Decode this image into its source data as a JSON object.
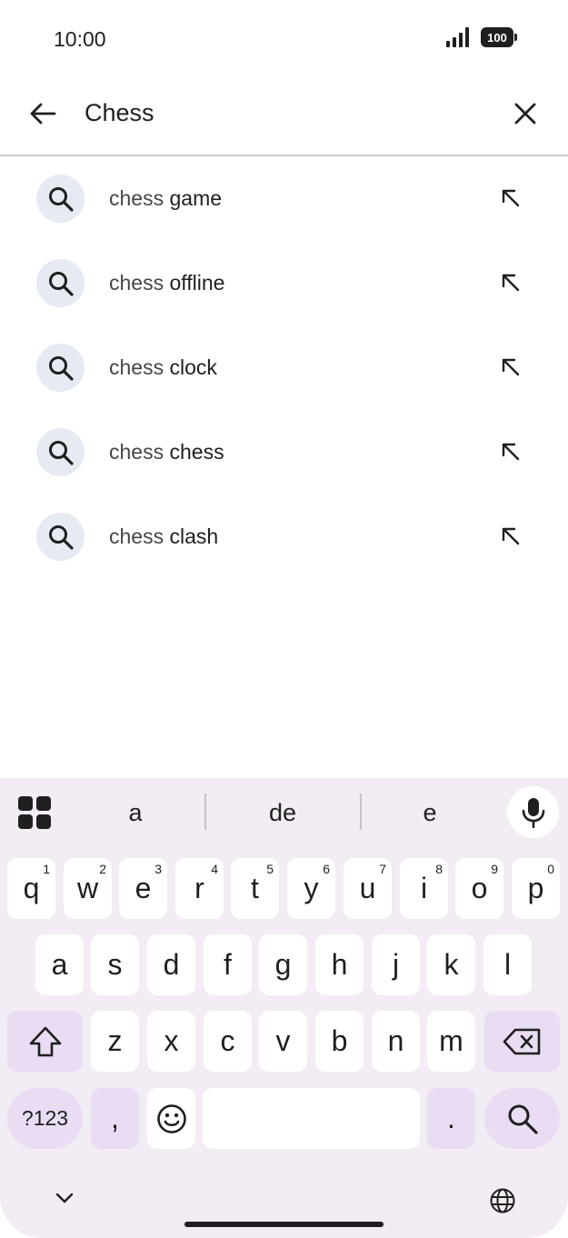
{
  "status": {
    "time": "10:00",
    "battery": "100",
    "signal": "signal-icon"
  },
  "search": {
    "query": "Chess",
    "back": "back-arrow-icon",
    "clear": "close-icon"
  },
  "suggestions": [
    {
      "prefix": "chess ",
      "rest": "game"
    },
    {
      "prefix": "chess ",
      "rest": "offline"
    },
    {
      "prefix": "chess ",
      "rest": "clock"
    },
    {
      "prefix": "chess ",
      "rest": "chess"
    },
    {
      "prefix": "chess ",
      "rest": "clash"
    }
  ],
  "keyboard": {
    "candidates": [
      "a",
      "de",
      "e"
    ],
    "row1": [
      {
        "k": "q",
        "s": "1"
      },
      {
        "k": "w",
        "s": "2"
      },
      {
        "k": "e",
        "s": "3"
      },
      {
        "k": "r",
        "s": "4"
      },
      {
        "k": "t",
        "s": "5"
      },
      {
        "k": "y",
        "s": "6"
      },
      {
        "k": "u",
        "s": "7"
      },
      {
        "k": "i",
        "s": "8"
      },
      {
        "k": "o",
        "s": "9"
      },
      {
        "k": "p",
        "s": "0"
      }
    ],
    "row2": [
      "a",
      "s",
      "d",
      "f",
      "g",
      "h",
      "j",
      "k",
      "l"
    ],
    "row3": [
      "z",
      "x",
      "c",
      "v",
      "b",
      "n",
      "m"
    ],
    "symbols_label": "?123",
    "comma": ",",
    "period": "."
  },
  "colors": {
    "accent_bg": "#f3ecf4",
    "function_key": "#e9dcf3",
    "suggestion_icon_bg": "#e5eaf3"
  }
}
